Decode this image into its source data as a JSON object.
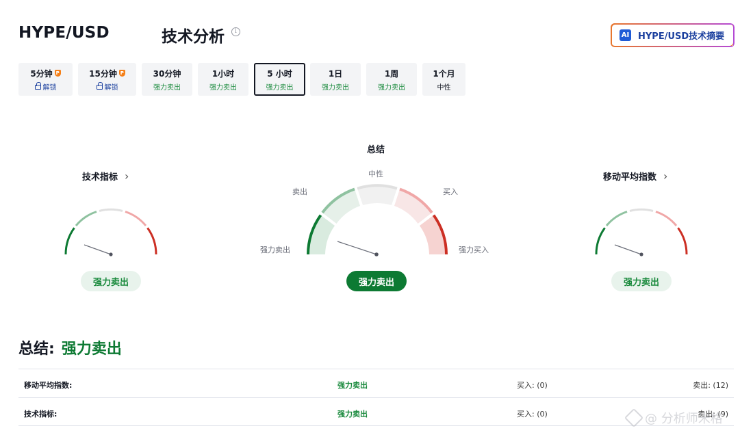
{
  "header": {
    "pair": "HYPE/USD",
    "title": "技术分析",
    "info_icon": "info-icon",
    "ai_button": {
      "badge": "AI",
      "label": "HYPE/USD技术摘要"
    }
  },
  "tabs": [
    {
      "name": "5分钟",
      "status": "解锁",
      "locked": true
    },
    {
      "name": "15分钟",
      "status": "解锁",
      "locked": true
    },
    {
      "name": "30分钟",
      "status": "强力卖出"
    },
    {
      "name": "1小时",
      "status": "强力卖出"
    },
    {
      "name": "5 小时",
      "status": "强力卖出",
      "active": true
    },
    {
      "name": "1日",
      "status": "强力卖出"
    },
    {
      "name": "1周",
      "status": "强力卖出"
    },
    {
      "name": "1个月",
      "status": "中性"
    }
  ],
  "gauges": {
    "summary": {
      "title": "总结",
      "labels": {
        "neutral": "中性",
        "sell": "卖出",
        "buy": "买入",
        "strong_sell": "强力卖出",
        "strong_buy": "强力买入"
      },
      "result": "强力卖出"
    },
    "technical": {
      "title": "技术指标",
      "result": "强力卖出"
    },
    "moving_averages": {
      "title": "移动平均指数",
      "result": "强力卖出"
    }
  },
  "summary": {
    "label": "总结:",
    "value": "强力卖出"
  },
  "table": {
    "rows": [
      {
        "name": "移动平均指数:",
        "summary": "强力卖出",
        "buy": "买入: (0)",
        "sell": "卖出: (12)"
      },
      {
        "name": "技术指标:",
        "summary": "强力卖出",
        "buy": "买入: (0)",
        "sell": "卖出: (9)"
      }
    ]
  },
  "watermark": "@ 分析师米格",
  "colors": {
    "strong_sell": "#0d7a33",
    "sell": "#8fc2a0",
    "neutral": "#e0e0e0",
    "buy": "#f0a7a7",
    "strong_buy": "#cc2f24",
    "accent": "#1a3f9e"
  }
}
